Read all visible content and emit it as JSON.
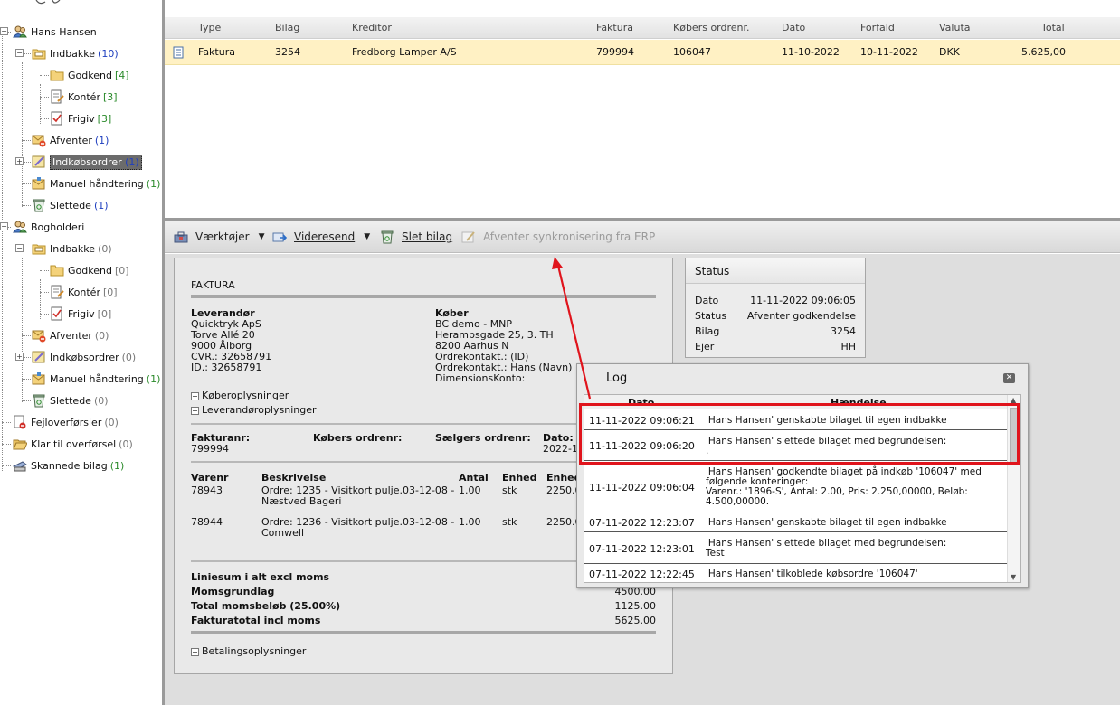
{
  "tree": {
    "items": [
      {
        "label": "Hans Hansen",
        "count": "",
        "count_color": "",
        "icon": "user-group-icon",
        "selected": false
      },
      {
        "label": "Indbakke",
        "count": "(10)",
        "count_color": "blue",
        "icon": "inbox-folder-icon",
        "selected": false
      },
      {
        "label": "Godkend",
        "count": "[4]",
        "count_color": "green",
        "icon": "folder-icon",
        "selected": false
      },
      {
        "label": "Kontér",
        "count": "[3]",
        "count_color": "green",
        "icon": "document-edit-icon",
        "selected": false
      },
      {
        "label": "Frigiv",
        "count": "[3]",
        "count_color": "green",
        "icon": "document-check-icon",
        "selected": false
      },
      {
        "label": "Afventer",
        "count": "(1)",
        "count_color": "blue",
        "icon": "envelope-blocked-icon",
        "selected": false
      },
      {
        "label": "Indkøbsordrer",
        "count": "(1)",
        "count_color": "blue",
        "icon": "purchase-order-icon",
        "selected": true
      },
      {
        "label": "Manuel håndtering",
        "count": "(1)",
        "count_color": "green",
        "icon": "envelope-hand-icon",
        "selected": false
      },
      {
        "label": "Slettede",
        "count": "(1)",
        "count_color": "blue",
        "icon": "recycle-bin-icon",
        "selected": false
      },
      {
        "label": "Bogholderi",
        "count": "",
        "count_color": "",
        "icon": "user-group-icon",
        "selected": false
      },
      {
        "label": "Indbakke",
        "count": "(0)",
        "count_color": "gray",
        "icon": "inbox-folder-icon",
        "selected": false
      },
      {
        "label": "Godkend",
        "count": "[0]",
        "count_color": "gray",
        "icon": "folder-icon",
        "selected": false
      },
      {
        "label": "Kontér",
        "count": "[0]",
        "count_color": "gray",
        "icon": "document-edit-icon",
        "selected": false
      },
      {
        "label": "Frigiv",
        "count": "[0]",
        "count_color": "gray",
        "icon": "document-check-icon",
        "selected": false
      },
      {
        "label": "Afventer",
        "count": "(0)",
        "count_color": "gray",
        "icon": "envelope-blocked-icon",
        "selected": false
      },
      {
        "label": "Indkøbsordrer",
        "count": "(0)",
        "count_color": "gray",
        "icon": "purchase-order-icon",
        "selected": false
      },
      {
        "label": "Manuel håndtering",
        "count": "(1)",
        "count_color": "green",
        "icon": "envelope-hand-icon",
        "selected": false
      },
      {
        "label": "Slettede",
        "count": "(0)",
        "count_color": "gray",
        "icon": "recycle-bin-icon",
        "selected": false
      },
      {
        "label": "Fejloverførsler",
        "count": "(0)",
        "count_color": "gray",
        "icon": "document-error-icon",
        "selected": false
      },
      {
        "label": "Klar til overførsel",
        "count": "(0)",
        "count_color": "gray",
        "icon": "folder-open-icon",
        "selected": false
      },
      {
        "label": "Skannede bilag",
        "count": "(1)",
        "count_color": "green",
        "icon": "scanner-icon",
        "selected": false
      }
    ]
  },
  "grid": {
    "columns": [
      "Type",
      "Bilag",
      "Kreditor",
      "Faktura",
      "Købers ordrenr.",
      "Dato",
      "Forfald",
      "Valuta",
      "Total"
    ],
    "rows": [
      {
        "type": "Faktura",
        "bilag": "3254",
        "kreditor": "Fredborg Lamper A/S",
        "faktura": "799994",
        "ordrenr": "106047",
        "dato": "11-10-2022",
        "forfald": "10-11-2022",
        "valuta": "DKK",
        "total": "5.625,00"
      }
    ]
  },
  "toolbar": {
    "tools_label": "Værktøjer",
    "forward_label": "Videresend",
    "delete_label": "Slet bilag",
    "await_sync_label": "Afventer synkronisering fra ERP"
  },
  "invoice": {
    "heading": "FAKTURA",
    "seller_heading": "Leverandør",
    "seller_lines": [
      "Quicktryk ApS",
      "Torve Allé 20",
      "9000 Ålborg",
      "CVR.: 32658791",
      "ID.: 32658791"
    ],
    "buyer_heading": "Køber",
    "buyer_lines": [
      "BC demo - MNP",
      "Herambsgade 25, 3. TH",
      "8200 Aarhus N",
      "Ordrekontakt.: (ID)",
      "Ordrekontakt.: Hans (Navn)",
      "DimensionsKonto:"
    ],
    "buyer_info_toggle": "Køberoplysninger",
    "seller_info_toggle": "Leverandøroplysninger",
    "invoice_no_label": "Fakturanr:",
    "invoice_no": "799994",
    "buyer_order_label": "Købers ordrenr:",
    "seller_order_label": "Sælgers ordrenr:",
    "date_label": "Dato:",
    "date_value": "2022-1",
    "lines_header": {
      "varenr": "Varenr",
      "beskrivelse": "Beskrivelse",
      "antal": "Antal",
      "enhed": "Enhed",
      "enhedspris": "Enhed"
    },
    "lines": [
      {
        "varenr": "78943",
        "desc1": "Ordre: 1235 - Visitkort pulje.03-12-08 -",
        "desc2": "Næstved Bageri",
        "antal": "1.00",
        "enhed": "stk",
        "pris": "2250.0"
      },
      {
        "varenr": "78944",
        "desc1": "Ordre: 1236 - Visitkort pulje.03-12-08 -",
        "desc2": "Comwell",
        "antal": "1.00",
        "enhed": "stk",
        "pris": "2250.0"
      }
    ],
    "totals": [
      {
        "label": "Liniesum i alt excl moms",
        "value": ""
      },
      {
        "label": "Momsgrundlag",
        "value": "4500.00"
      },
      {
        "label": "Total momsbeløb (25.00%)",
        "value": "1125.00"
      },
      {
        "label": "Fakturatotal incl moms",
        "value": "5625.00"
      }
    ],
    "payment_toggle": "Betalingsoplysninger"
  },
  "status": {
    "title": "Status",
    "rows": [
      {
        "k": "Dato",
        "v": "11-11-2022 09:06:05"
      },
      {
        "k": "Status",
        "v": "Afventer godkendelse"
      },
      {
        "k": "Bilag",
        "v": "3254"
      },
      {
        "k": "Ejer",
        "v": "HH"
      }
    ]
  },
  "log": {
    "title": "Log",
    "col_date": "Dato",
    "col_event": "Hændelse",
    "rows": [
      {
        "date": "11-11-2022 09:06:21",
        "event": "'Hans Hansen' genskabte bilaget til egen indbakke"
      },
      {
        "date": "11-11-2022 09:06:20",
        "event": "'Hans Hansen' slettede bilaget med begrundelsen:\n."
      },
      {
        "date": "11-11-2022 09:06:04",
        "event": "'Hans Hansen' godkendte bilaget på indkøb '106047' med\nfølgende konteringer:\nVarenr.: '1896-S', Antal: 2.00, Pris: 2.250,00000, Beløb:\n4.500,00000."
      },
      {
        "date": "07-11-2022 12:23:07",
        "event": "'Hans Hansen' genskabte bilaget til egen indbakke"
      },
      {
        "date": "07-11-2022 12:23:01",
        "event": "'Hans Hansen' slettede bilaget med begrundelsen:\nTest"
      },
      {
        "date": "07-11-2022 12:22:45",
        "event": "'Hans Hansen' tilkoblede købsordre '106047'"
      }
    ]
  },
  "colors": {
    "selected_row": "#fff1c4",
    "highlight": "#e0141c",
    "count_blue": "#1f3fbf",
    "count_green": "#2a8a2a"
  }
}
